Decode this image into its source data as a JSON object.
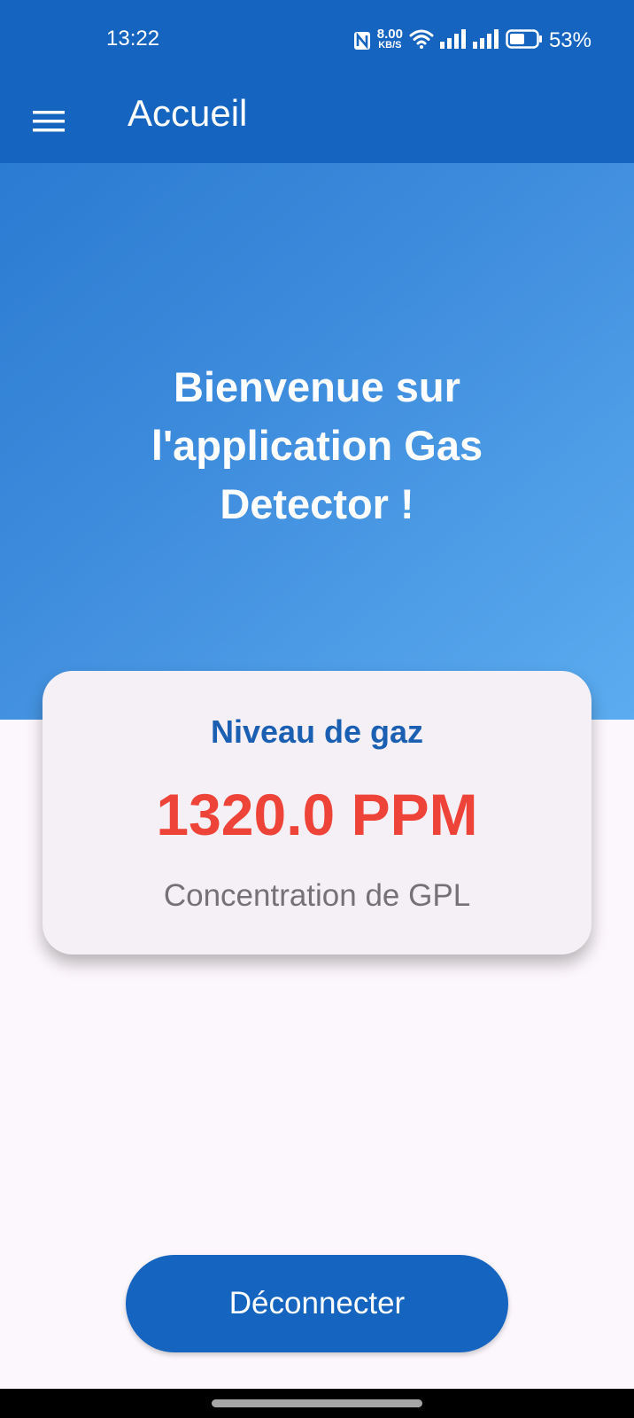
{
  "status_bar": {
    "time": "13:22",
    "net_speed_value": "8.00",
    "net_speed_unit": "KB/S",
    "battery_percent": "53%"
  },
  "app_bar": {
    "title": "Accueil",
    "menu_icon": "hamburger-menu-icon"
  },
  "hero": {
    "welcome_text": "Bienvenue sur l'application Gas Detector !"
  },
  "gas_card": {
    "title": "Niveau de gaz",
    "value": "1320.0 PPM",
    "caption": "Concentration de GPL"
  },
  "actions": {
    "logout_label": "Déconnecter"
  },
  "colors": {
    "primary": "#1565c0",
    "value_red": "#ee4338",
    "card_title_blue": "#1b5fb3",
    "background": "#fcf7fc"
  },
  "status_icons": [
    "nfc-icon",
    "wifi-icon",
    "signal-icon",
    "signal-icon",
    "battery-icon"
  ]
}
